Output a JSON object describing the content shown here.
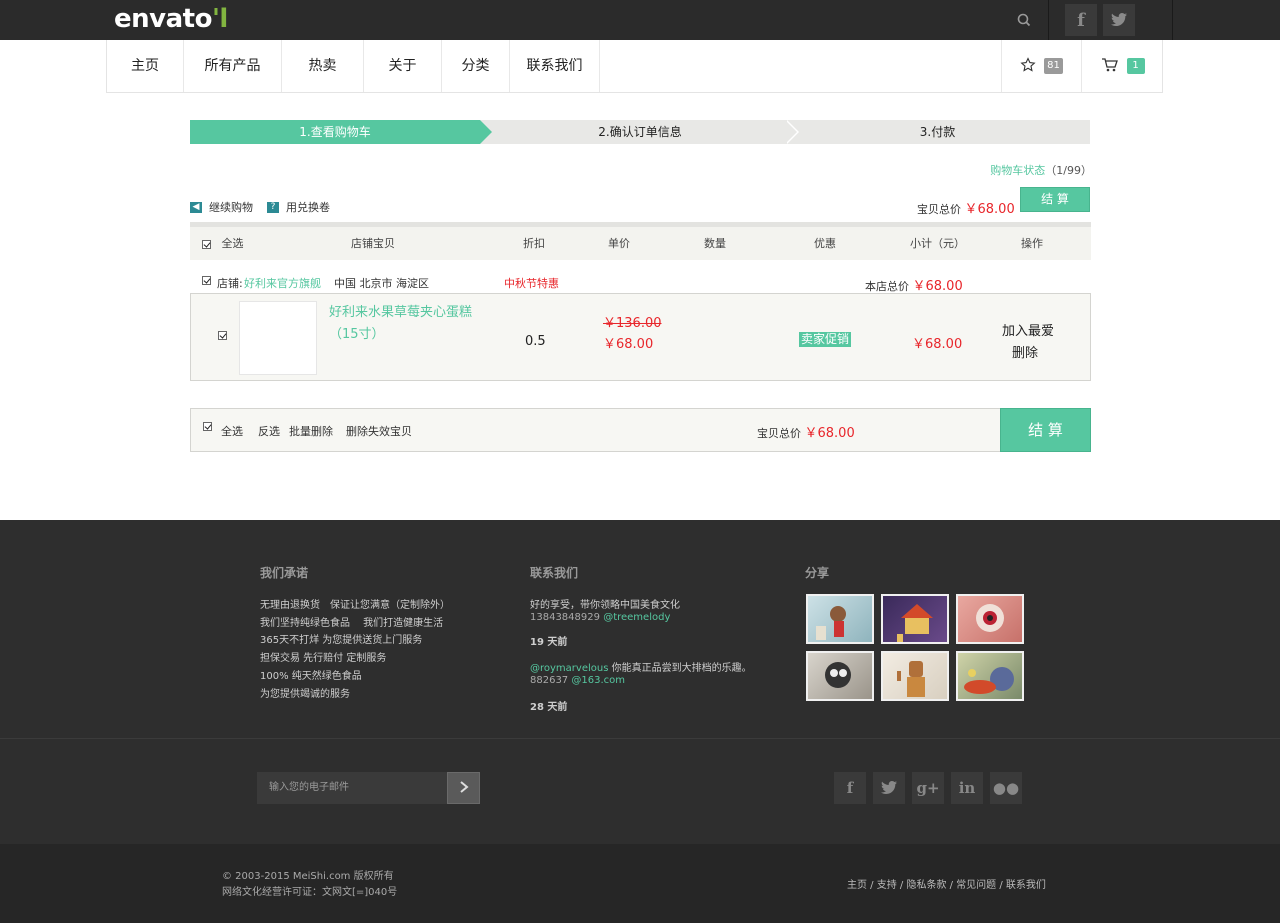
{
  "brand": {
    "logo": "envato",
    "accent": "#56c7a0",
    "price_color": "#e8262b"
  },
  "nav": {
    "items": [
      "主页",
      "所有产品",
      "热卖",
      "关于",
      "分类",
      "联系我们"
    ],
    "favorites_count": "81",
    "cart_count": "1"
  },
  "steps": [
    "1.查看购物车",
    "2.确认订单信息",
    "3.付款"
  ],
  "cart_status": {
    "label": "购物车状态",
    "count": "（1/99）"
  },
  "tools": {
    "continue": "继续购物",
    "coupon": "用兑换卷"
  },
  "summary_top": {
    "label": "宝贝总价",
    "price": "￥68.00",
    "checkout": "结 算"
  },
  "table_headers": {
    "select_all": "全选",
    "product": "店铺宝贝",
    "discount": "折扣",
    "unit_price": "单价",
    "quantity": "数量",
    "promo": "优惠",
    "subtotal": "小计（元）",
    "action": "操作"
  },
  "shop": {
    "prefix": "店铺:",
    "name": "好利来官方旗舰",
    "location": "中国 北京市 海淀区",
    "event": "中秋节特惠",
    "total_label": "本店总价",
    "total": "￥68.00"
  },
  "item": {
    "name": "好利来水果草莓夹心蛋糕",
    "size": "（15寸）",
    "discount": "0.5",
    "original_price": "￥136.00",
    "price": "￥68.00",
    "promo_badge": "卖家促销",
    "subtotal": "￥68.00",
    "add_fav": "加入最爱",
    "delete": "删除"
  },
  "bottom_bar": {
    "select_all": "全选",
    "invert": "反选",
    "batch_delete": "批量删除",
    "delete_invalid": "删除失效宝贝",
    "total_label": "宝贝总价",
    "total": "￥68.00",
    "checkout": "结 算"
  },
  "footer": {
    "promise_title": "我们承诺",
    "promises": [
      "无理由退换货　保证让您满意（定制除外）",
      "我们坚持纯绿色食品　 我们打造健康生活",
      "365天不打烊 为您提供送货上门服务",
      "担保交易 先行赔付 定制服务",
      "100% 纯天然绿色食品",
      "为您提供竭诚的服务"
    ],
    "contact_title": "联系我们",
    "contacts": [
      {
        "text": "好的享受，带你领略中国美食文化",
        "meta": "13843848929",
        "handle": "@treemelody",
        "time": "19 天前"
      },
      {
        "handle2": "@roymarvelous",
        "text2": "你能真正品尝到大排档的乐趣。",
        "meta2": "882637",
        "handle3": "@163.com",
        "time": "28 天前"
      }
    ],
    "share_title": "分享",
    "email_placeholder": "输入您的电子邮件",
    "copyright": "© 2003-2015 MeiShi.com 版权所有",
    "license": "网络文化经营许可证：文网文[=]040号",
    "links": "主页 / 支持 / 隐私条款 / 常见问题 / 联系我们"
  }
}
